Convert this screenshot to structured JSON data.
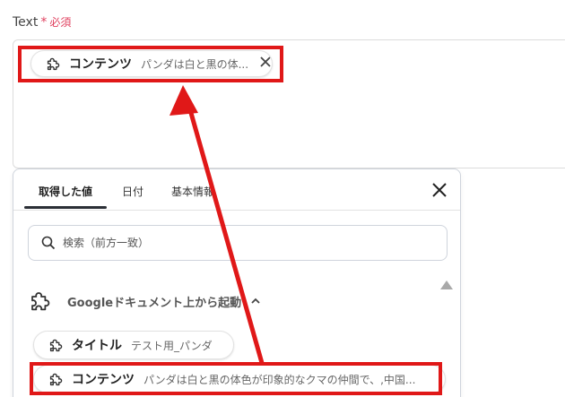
{
  "field": {
    "label": "Text",
    "required_mark": "*",
    "required_text": "必須"
  },
  "selected_chip": {
    "name": "コンテンツ",
    "value": "パンダは白と黒の体...",
    "icon": "puzzle-icon"
  },
  "dropdown": {
    "tabs": [
      {
        "label": "取得した値",
        "active": true
      },
      {
        "label": "日付",
        "active": false
      },
      {
        "label": "基本情報",
        "active": false
      }
    ],
    "search": {
      "placeholder": "検索（前方一致）"
    },
    "group": {
      "title": "Googleドキュメント上から起動",
      "icon": "puzzle-icon",
      "expanded": true
    },
    "items": [
      {
        "name": "タイトル",
        "value": "テスト用_パンダ",
        "icon": "puzzle-icon"
      },
      {
        "name": "コンテンツ",
        "value": "パンダは白と黒の体色が印象的なクマの仲間で、,中国...",
        "icon": "puzzle-icon"
      }
    ]
  },
  "colors": {
    "required": "#e0415f",
    "annotation": "#e01818",
    "tab_underline": "#2b2f36",
    "border": "#cfd4dc"
  }
}
